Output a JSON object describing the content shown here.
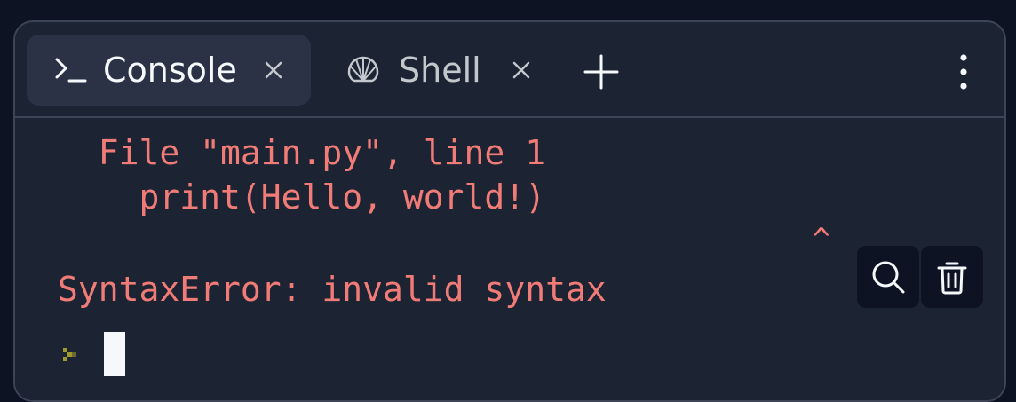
{
  "tabs": [
    {
      "label": "Console",
      "icon": "terminal-prompt-icon",
      "active": true
    },
    {
      "label": "Shell",
      "icon": "shell-icon",
      "active": false
    }
  ],
  "output": {
    "lines": [
      "  File \"main.py\", line 1",
      "    print(Hello, world!)",
      "                ^",
      "SyntaxError: invalid syntax"
    ]
  },
  "colors": {
    "background": "#0e1324",
    "panel": "#1c2333",
    "active_tab": "#2b3245",
    "error_text": "#f17b76",
    "prompt": "#a09a2c",
    "foreground": "#f5f9fc"
  }
}
